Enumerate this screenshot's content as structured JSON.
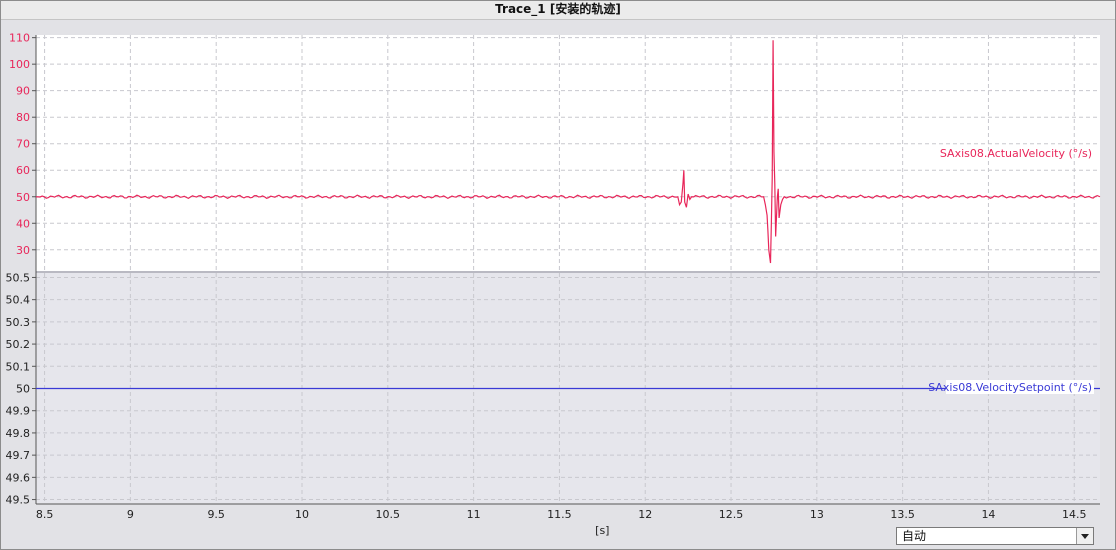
{
  "window": {
    "title": "Trace_1 [安装的轨迹]"
  },
  "colors": {
    "actual": "#e8265a",
    "setpoint": "#3a3ad6",
    "upper_bg": "#ffffff",
    "lower_bg": "#e6e6ec",
    "grid": "#c8c8ce"
  },
  "controls": {
    "scale_mode": "自动",
    "dropdown_icon": "chevron-down-icon"
  },
  "chart_data": [
    {
      "type": "line",
      "title": "",
      "xlabel": "[s]",
      "xlim": [
        8.45,
        14.65
      ],
      "x_ticks": [
        "8.5",
        "9",
        "9.5",
        "10",
        "10.5",
        "11",
        "11.5",
        "12",
        "12.5",
        "13",
        "13.5",
        "14",
        "14.5"
      ],
      "ylim": [
        22,
        111
      ],
      "y_ticks": [
        "110",
        "100",
        "90",
        "80",
        "70",
        "60",
        "50",
        "40",
        "30"
      ],
      "grid": true,
      "series": [
        {
          "name": "SAxis08.ActualVelocity (°/s)",
          "baseline": 50,
          "points": [
            [
              8.45,
              50
            ],
            [
              12.19,
              50
            ],
            [
              12.2,
              47
            ],
            [
              12.21,
              48
            ],
            [
              12.22,
              55
            ],
            [
              12.225,
              60
            ],
            [
              12.23,
              48
            ],
            [
              12.24,
              46
            ],
            [
              12.25,
              51
            ],
            [
              12.26,
              49
            ],
            [
              12.27,
              50
            ],
            [
              12.69,
              50
            ],
            [
              12.7,
              47
            ],
            [
              12.71,
              43
            ],
            [
              12.715,
              37
            ],
            [
              12.72,
              30
            ],
            [
              12.73,
              25
            ],
            [
              12.735,
              40
            ],
            [
              12.74,
              57
            ],
            [
              12.745,
              109
            ],
            [
              12.75,
              67
            ],
            [
              12.755,
              55
            ],
            [
              12.76,
              35
            ],
            [
              12.77,
              50
            ],
            [
              12.775,
              53
            ],
            [
              12.78,
              42
            ],
            [
              12.79,
              47
            ],
            [
              12.8,
              49
            ],
            [
              12.81,
              50
            ],
            [
              14.65,
              50
            ]
          ]
        }
      ]
    },
    {
      "type": "line",
      "title": "",
      "xlim": [
        8.45,
        14.65
      ],
      "ylim": [
        49.48,
        50.52
      ],
      "y_ticks": [
        "50.5",
        "50.4",
        "50.3",
        "50.2",
        "50.1",
        "50",
        "49.9",
        "49.8",
        "49.7",
        "49.6",
        "49.5"
      ],
      "grid": true,
      "series": [
        {
          "name": "SAxis08.VelocitySetpoint (°/s)",
          "points": [
            [
              8.45,
              50
            ],
            [
              14.65,
              50
            ]
          ]
        }
      ]
    }
  ]
}
